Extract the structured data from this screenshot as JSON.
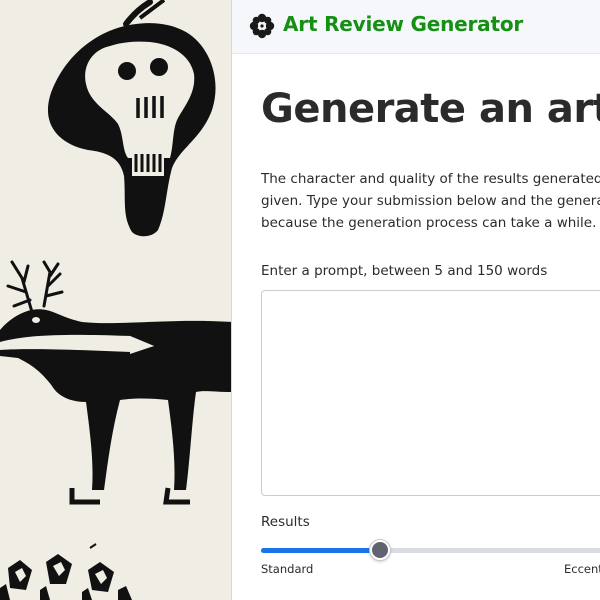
{
  "brand": {
    "title": "Art Review Generator",
    "color": "#159015",
    "logo_icon": "flower-icon"
  },
  "page": {
    "title": "Generate an art re",
    "intro_lines": [
      "The character and quality of the results generated by",
      "given. Type your submission below and the generate",
      "because the generation process can take a while. Ch"
    ]
  },
  "prompt": {
    "label": "Enter a prompt, between 5 and 150 words",
    "value": "",
    "placeholder": ""
  },
  "results": {
    "label": "Results",
    "slider_min_label": "Standard",
    "slider_max_label": "Eccentr",
    "slider_value_fraction": 0.33,
    "accent_color": "#1a73e8"
  },
  "art_panel": {
    "icons": [
      "skull-figure-icon",
      "deer-figure-icon",
      "bird-figures-icon"
    ]
  }
}
